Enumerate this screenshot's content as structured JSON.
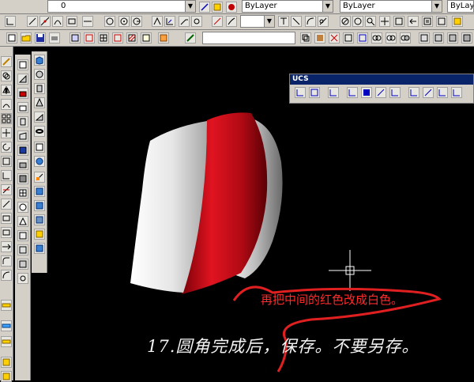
{
  "toolbar_row1": {
    "layer_value": "0",
    "color_value": "ByLayer",
    "linetype_value": "ByLayer",
    "lineweight_value": "ByLayer"
  },
  "ucs_toolbar": {
    "title": "UCS"
  },
  "annotations": {
    "red_note": "再把中间的红色改成白色。",
    "step_text": "17.圆角完成后，保存。不要另存。"
  },
  "icons": [
    "line-icon",
    "arc-icon",
    "circle-icon",
    "zoom-icon",
    "pan-icon",
    "box-icon",
    "sphere-icon",
    "cylinder-icon",
    "cone-icon",
    "wedge-icon",
    "torus-icon",
    "move-icon",
    "rotate-icon",
    "mirror-icon",
    "array-icon",
    "union-icon",
    "subtract-icon",
    "ucs-icon",
    "crosshair-icon"
  ],
  "colors": {
    "background": "#000000",
    "red_band": "#c0101a",
    "toolbar": "#d4d0c8",
    "annotation_red": "#ff2a2a"
  }
}
